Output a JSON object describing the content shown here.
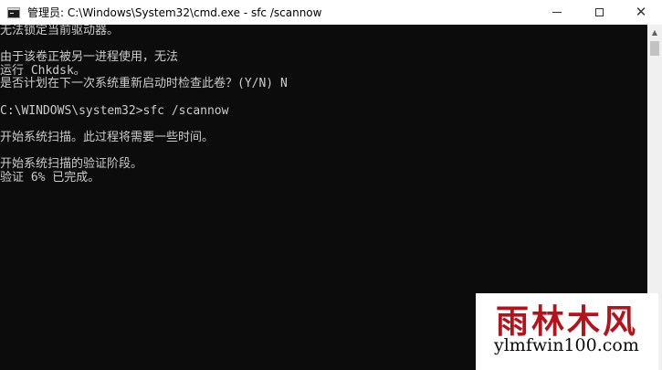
{
  "window": {
    "title": "管理员: C:\\Windows\\System32\\cmd.exe - sfc  /scannow",
    "controls": {
      "minimize": "—",
      "maximize": "☐",
      "close": "✕"
    }
  },
  "console": {
    "lines": [
      "无法锁定当前驱动器。",
      "",
      "由于该卷正被另一进程使用，无法",
      "运行 Chkdsk。",
      "是否计划在下一次系统重新启动时检查此卷？(Y/N) N",
      "",
      "C:\\WINDOWS\\system32>sfc /scannow",
      "",
      "开始系统扫描。此过程将需要一些时间。",
      "",
      "开始系统扫描的验证阶段。",
      "验证 6% 已完成。"
    ]
  },
  "watermark": {
    "cn": "雨林木风",
    "url": "ylmfwin100.com"
  },
  "colors": {
    "console_bg": "#0c0c0c",
    "console_text": "#cccccc",
    "watermark_red": "#b5121b"
  }
}
